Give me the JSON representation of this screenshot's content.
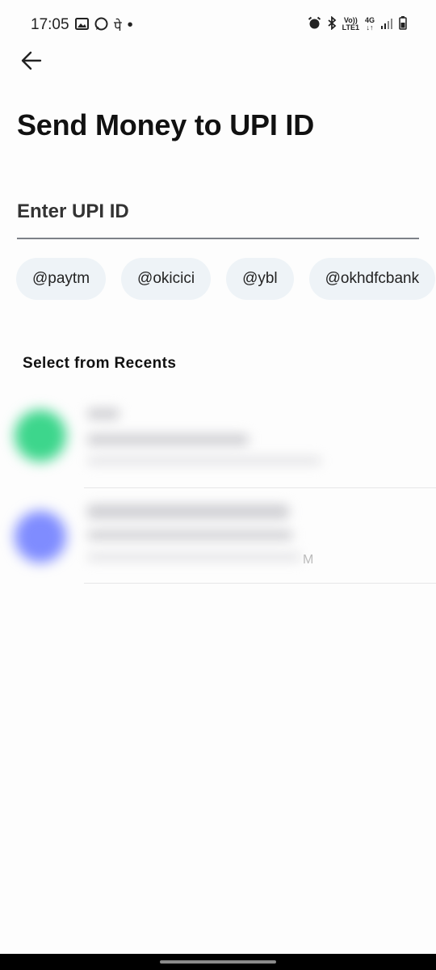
{
  "status_bar": {
    "time": "17:05",
    "icons_left": [
      "image-icon",
      "whatsapp-icon",
      "pe-icon",
      "dot-icon"
    ],
    "icons_right": [
      "alarm-icon",
      "bluetooth-icon",
      "volte-icon",
      "4g-icon",
      "signal-icon",
      "battery-icon"
    ],
    "volte_label": "Vo))",
    "lte_label": "LTE1",
    "network_label": "4G"
  },
  "header": {
    "title": "Send Money to UPI ID"
  },
  "upi_input": {
    "placeholder": "Enter UPI ID",
    "value": ""
  },
  "suggestion_chips": [
    "@paytm",
    "@okicici",
    "@ybl",
    "@okhdfcbank"
  ],
  "recents": {
    "title": "Select from Recents",
    "items": [
      {
        "avatar_color": "#3dd68c",
        "trailing": ""
      },
      {
        "avatar_color": "#7f8cff",
        "trailing": "M"
      }
    ]
  },
  "colors": {
    "accent_underline": "#7d8188",
    "chip_bg": "#eef3f7"
  }
}
